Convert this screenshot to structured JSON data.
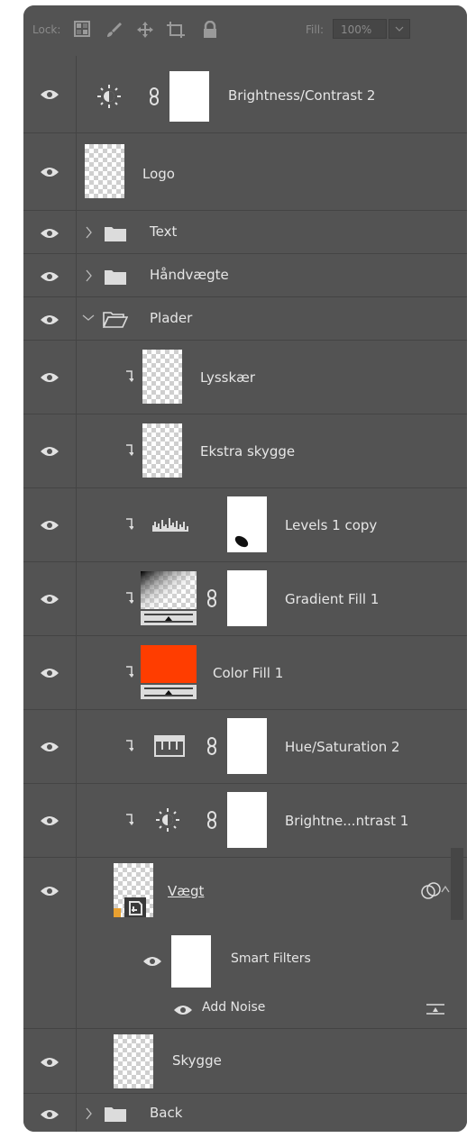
{
  "lockbar": {
    "lock_label": "Lock:",
    "fill_label": "Fill:",
    "fill_value": "100%"
  },
  "layers": {
    "brightness2": "Brightness/Contrast 2",
    "logo": "Logo",
    "text_group": "Text",
    "handvaegte_group": "Håndvægte",
    "plader_group": "Plader",
    "lysskaer": "Lysskær",
    "ekstra_skygge": "Ekstra skygge",
    "levels_copy": "Levels 1 copy",
    "gradient_fill": "Gradient Fill 1",
    "color_fill": "Color Fill 1",
    "hue_sat": "Hue/Saturation 2",
    "brightness1": "Brightne...ntrast 1",
    "vaegt": "Vægt",
    "smart_filters": "Smart Filters",
    "add_noise": "Add Noise",
    "skygge": "Skygge",
    "back_group": "Back"
  },
  "colors": {
    "panel_bg": "#535353",
    "color_fill_swatch": "#ff3d00"
  }
}
